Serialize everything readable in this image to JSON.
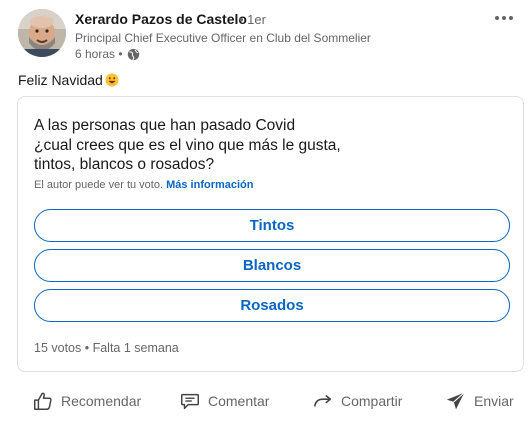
{
  "post": {
    "author": {
      "name": "Xerardo Pazos de Castelo",
      "degree": "• 1er",
      "headline": "Principal Chief Executive Officer en Club del Sommelier",
      "time": "6 horas •"
    },
    "text": "Feliz Navidad",
    "emoji_icon": "smiling-face-emoji",
    "visibility_icon": "globe-icon",
    "menu_icon": "more-icon"
  },
  "poll": {
    "question_lines": [
      "A las personas que han pasado Covid",
      "¿cual crees que es el vino que más le gusta,",
      "tintos, blancos o rosados?"
    ],
    "note": "El autor puede ver tu voto.",
    "note_link": "Más información",
    "options": [
      "Tintos",
      "Blancos",
      "Rosados"
    ],
    "footer": "15 votos • Falta 1 semana"
  },
  "actions": [
    {
      "label": "Recomendar",
      "icon": "thumbs-up-icon"
    },
    {
      "label": "Comentar",
      "icon": "comment-icon"
    },
    {
      "label": "Compartir",
      "icon": "share-icon"
    },
    {
      "label": "Enviar",
      "icon": "send-icon"
    }
  ],
  "colors": {
    "accent": "#0a66c2",
    "text_primary": "#191919",
    "text_secondary": "#666666",
    "border": "#e0e0e0"
  }
}
